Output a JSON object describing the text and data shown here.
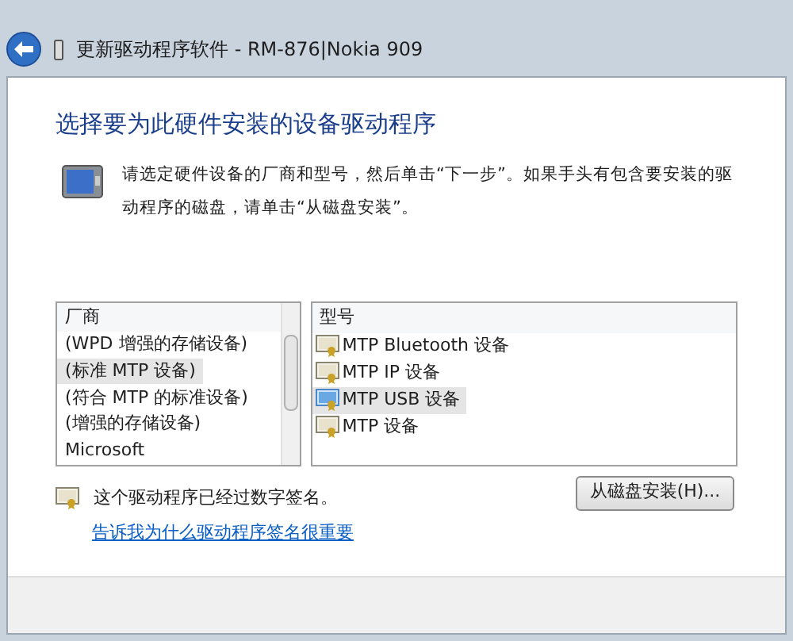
{
  "window": {
    "title": "更新驱动程序软件 - RM-876|Nokia 909"
  },
  "heading": "选择要为此硬件安装的设备驱动程序",
  "description": "请选定硬件设备的厂商和型号，然后单击“下一步”。如果手头有包含要安装的驱动程序的磁盘，请单击“从磁盘安装”。",
  "manufacturers": {
    "header": "厂商",
    "items": [
      {
        "label": "(WPD 增强的存储设备)",
        "selected": false
      },
      {
        "label": "(标准 MTP 设备)",
        "selected": true
      },
      {
        "label": "(符合 MTP 的标准设备)",
        "selected": false
      },
      {
        "label": "(增强的存储设备)",
        "selected": false
      },
      {
        "label": "Microsoft",
        "selected": false
      }
    ]
  },
  "models": {
    "header": "型号",
    "items": [
      {
        "label": "MTP Bluetooth 设备",
        "selected": false
      },
      {
        "label": "MTP IP 设备",
        "selected": false
      },
      {
        "label": "MTP USB 设备",
        "selected": true
      },
      {
        "label": "MTP 设备",
        "selected": false
      }
    ]
  },
  "signature": {
    "text": "这个驱动程序已经过数字签名。",
    "link": "告诉我为什么驱动程序签名很重要"
  },
  "buttons": {
    "have_disk": "从磁盘安装(H)..."
  }
}
